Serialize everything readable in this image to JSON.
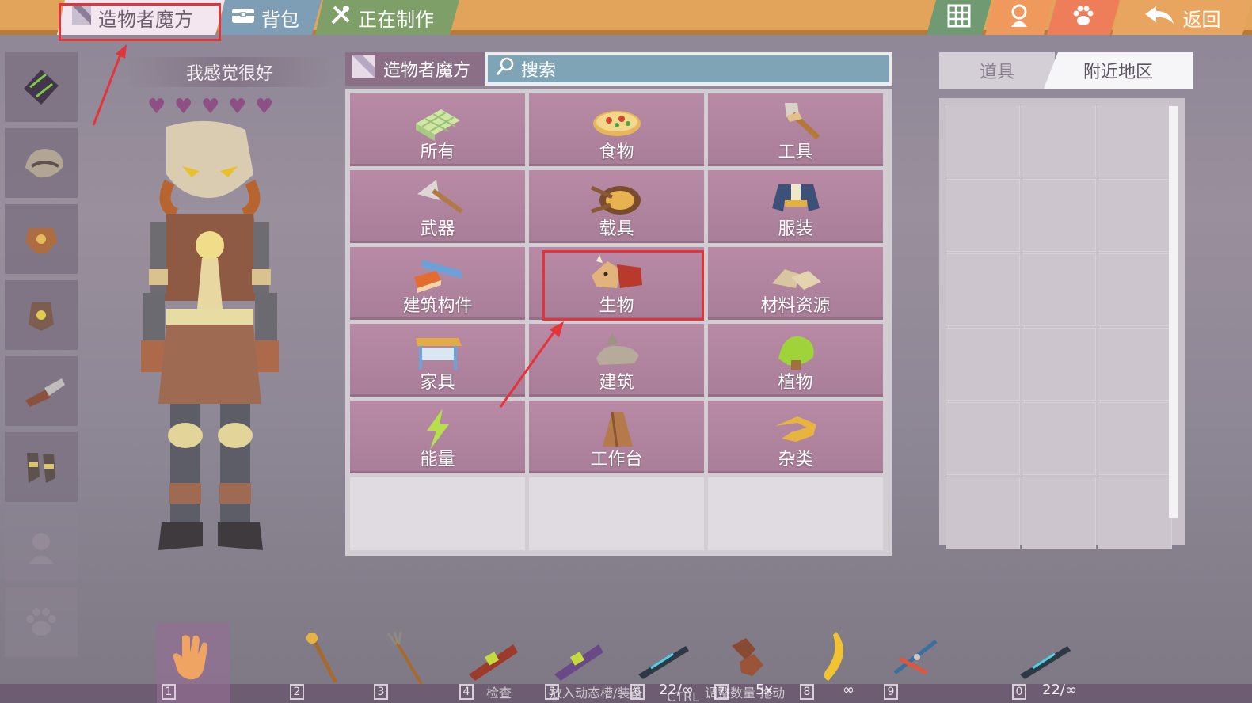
{
  "topbar": {
    "tabs": [
      {
        "label": "造物者魔方",
        "icon": "cube-icon"
      },
      {
        "label": "背包",
        "icon": "backpack-icon"
      },
      {
        "label": "正在制作",
        "icon": "wrench-icon"
      }
    ],
    "right_buttons": [
      {
        "icon": "grid-icon"
      },
      {
        "icon": "user-icon"
      },
      {
        "icon": "paw-icon"
      },
      {
        "icon": "back-arrow-icon",
        "label": "返回"
      }
    ]
  },
  "character": {
    "status": "我感觉很好",
    "hearts": 5
  },
  "crafting": {
    "title": "造物者魔方",
    "search_placeholder": "搜索",
    "categories": [
      {
        "label": "所有",
        "icon": "all-blocks-icon"
      },
      {
        "label": "食物",
        "icon": "pizza-icon"
      },
      {
        "label": "工具",
        "icon": "hammer-icon"
      },
      {
        "label": "武器",
        "icon": "axe-icon"
      },
      {
        "label": "载具",
        "icon": "wheel-icon"
      },
      {
        "label": "服装",
        "icon": "jacket-icon"
      },
      {
        "label": "建筑构件",
        "icon": "beam-icon"
      },
      {
        "label": "生物",
        "icon": "creature-icon"
      },
      {
        "label": "材料资源",
        "icon": "rock-icon"
      },
      {
        "label": "家具",
        "icon": "table-icon"
      },
      {
        "label": "建筑",
        "icon": "statue-icon"
      },
      {
        "label": "植物",
        "icon": "plant-icon"
      },
      {
        "label": "能量",
        "icon": "lightning-icon"
      },
      {
        "label": "工作台",
        "icon": "workbench-icon"
      },
      {
        "label": "杂类",
        "icon": "misc-icon"
      }
    ]
  },
  "nearby": {
    "tabs": [
      "道具",
      "附近地区"
    ]
  },
  "hotbar": {
    "slots": [
      {
        "num": "1",
        "icon": "hand-icon"
      },
      {
        "num": "2",
        "icon": "torch-icon"
      },
      {
        "num": "3",
        "icon": "pitchfork-icon"
      },
      {
        "num": "4",
        "icon": "launcher-icon"
      },
      {
        "num": "5",
        "icon": "launcher-icon"
      },
      {
        "num": "6",
        "icon": "rifle-icon",
        "count": "22/∞"
      },
      {
        "num": "7",
        "icon": "meat-icon",
        "count": "5x"
      },
      {
        "num": "8",
        "icon": "banana-icon",
        "count": "∞"
      },
      {
        "num": "9",
        "icon": "shears-icon"
      },
      {
        "num": "0",
        "icon": "rifle-icon",
        "count": "22/∞"
      }
    ],
    "hints": [
      "检查",
      "放入动态槽/装备",
      "调整数量 拖动"
    ],
    "hint_keys": [
      "CTRL"
    ]
  }
}
